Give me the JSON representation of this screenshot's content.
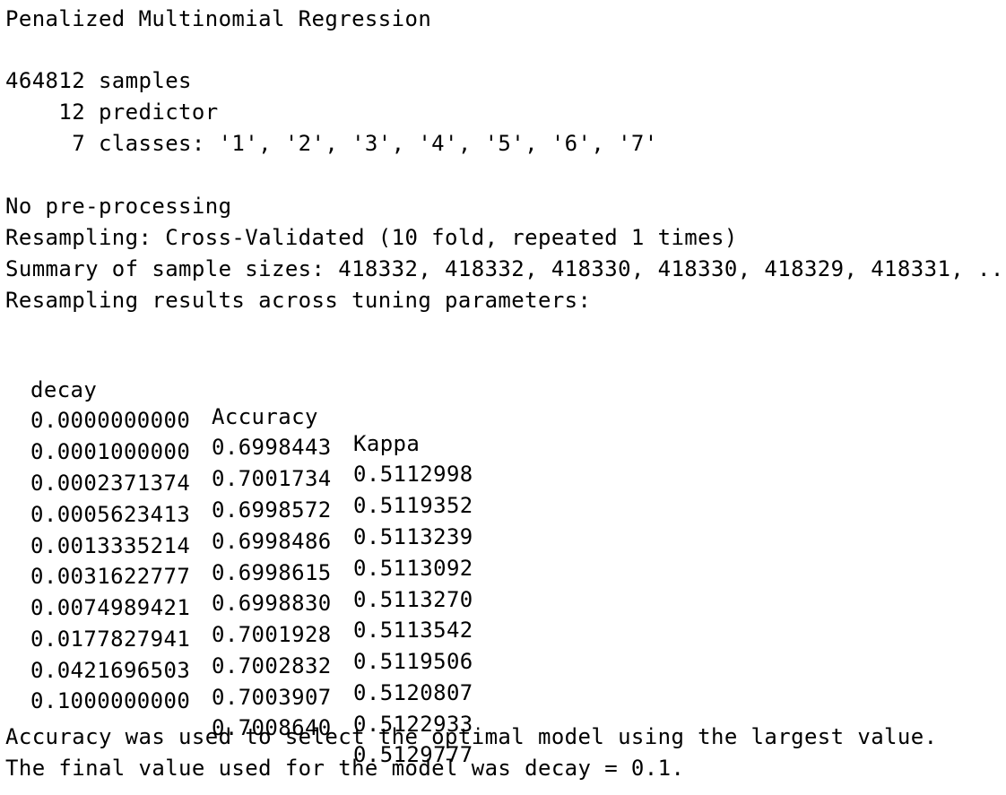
{
  "output": {
    "model_name": "Penalized Multinomial Regression",
    "samples_line": "464812 samples",
    "predictors_line": "    12 predictor",
    "classes_line": "     7 classes: '1', '2', '3', '4', '5', '6', '7'",
    "preprocessing": "No pre-processing",
    "resampling": "Resampling: Cross-Validated (10 fold, repeated 1 times)",
    "sample_sizes": "Summary of sample sizes: 418332, 418332, 418330, 418330, 418329, 418331, ...",
    "results_header": "Resampling results across tuning parameters:",
    "table": {
      "headers": [
        "decay",
        "Accuracy",
        "Kappa"
      ],
      "rows": [
        [
          "0.0000000000",
          "0.6998443",
          "0.5112998"
        ],
        [
          "0.0001000000",
          "0.7001734",
          "0.5119352"
        ],
        [
          "0.0002371374",
          "0.6998572",
          "0.5113239"
        ],
        [
          "0.0005623413",
          "0.6998486",
          "0.5113092"
        ],
        [
          "0.0013335214",
          "0.6998615",
          "0.5113270"
        ],
        [
          "0.0031622777",
          "0.6998830",
          "0.5113542"
        ],
        [
          "0.0074989421",
          "0.7001928",
          "0.5119506"
        ],
        [
          "0.0177827941",
          "0.7002832",
          "0.5120807"
        ],
        [
          "0.0421696503",
          "0.7003907",
          "0.5122933"
        ],
        [
          "0.1000000000",
          "0.7008640",
          "0.5129777"
        ]
      ]
    },
    "selection_note": "Accuracy was used to select the optimal model using the largest value.",
    "final_value_note": "The final value used for the model was decay = 0.1."
  }
}
